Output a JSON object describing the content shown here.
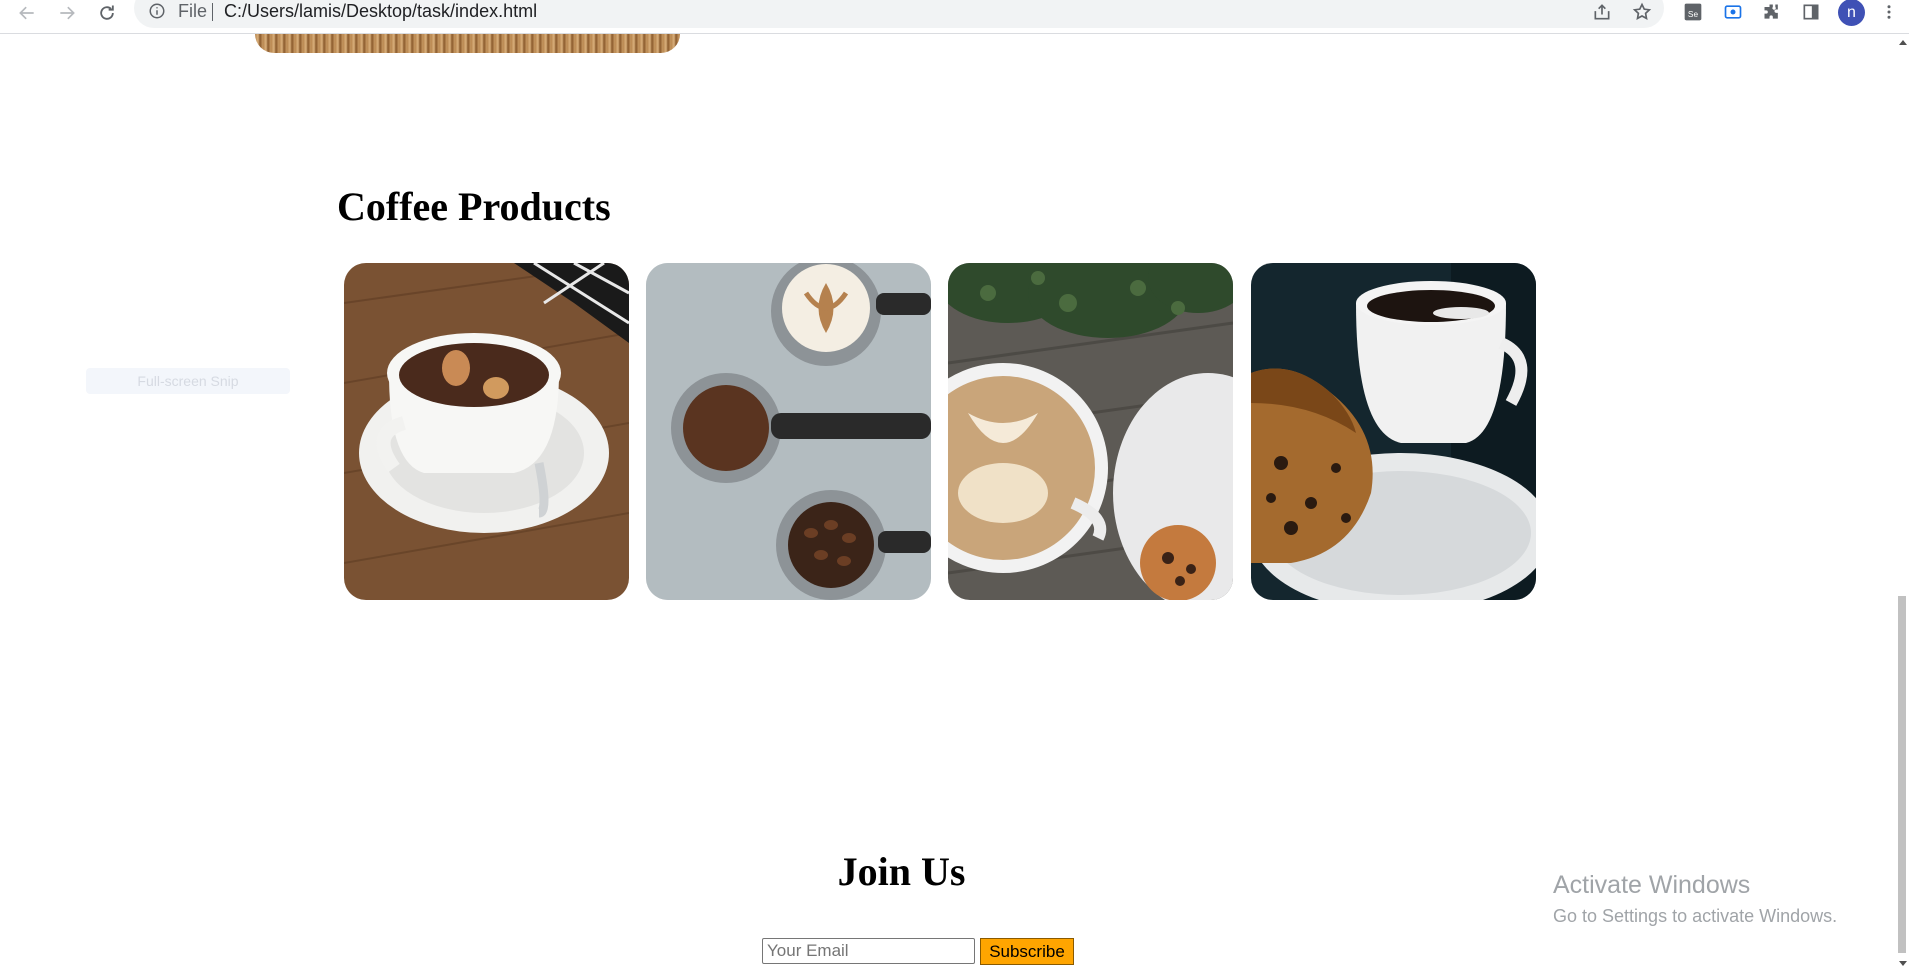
{
  "browser": {
    "address_scheme": "File",
    "url": "C:/Users/lamis/Desktop/task/index.html",
    "profile_initial": "n",
    "accent_color": "#3f51b5"
  },
  "page": {
    "ghost_button_label": "Full-screen Snip",
    "products": {
      "title": "Coffee Products",
      "cards": [
        {
          "icon": "cocoa-cup-image"
        },
        {
          "icon": "espresso-portafilters-image"
        },
        {
          "icon": "latte-art-image"
        },
        {
          "icon": "coffee-and-cake-image"
        }
      ]
    },
    "join": {
      "title": "Join Us",
      "email_placeholder": "Your Email",
      "subscribe_label": "Subscribe",
      "subscribe_color": "#ffa500"
    }
  },
  "overlay": {
    "activate_title": "Activate Windows",
    "activate_subtitle": "Go to Settings to activate Windows."
  }
}
